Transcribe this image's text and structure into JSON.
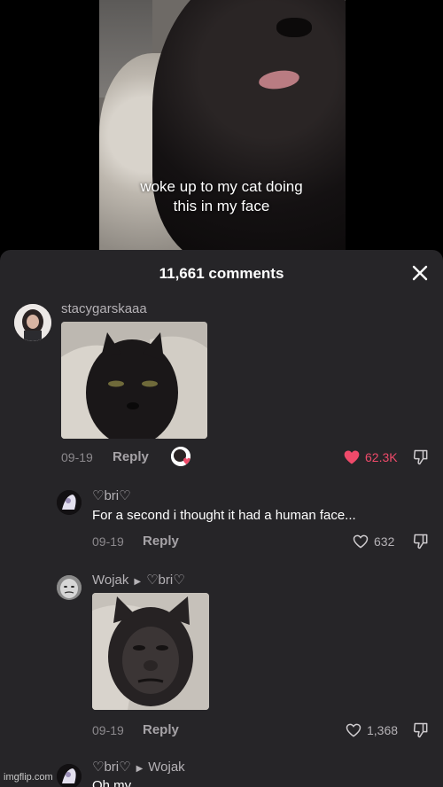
{
  "video": {
    "caption_line1": "woke up to my cat doing",
    "caption_line2": "this in my face"
  },
  "comments_sheet": {
    "title": "11,661 comments",
    "close_icon": "close-icon"
  },
  "comments": [
    {
      "username": "stacygarskaaa",
      "date": "09-19",
      "reply_label": "Reply",
      "likes": "62.3K",
      "liked": true,
      "has_image": true
    },
    {
      "username": "♡bri♡",
      "text": "For a second i thought it had a human face...",
      "date": "09-19",
      "reply_label": "Reply",
      "likes": "632"
    },
    {
      "username": "Wojak",
      "reply_to": "♡bri♡",
      "date": "09-19",
      "reply_label": "Reply",
      "likes": "1,368",
      "has_image": true
    },
    {
      "username": "♡bri♡",
      "reply_to": "Wojak",
      "text": "Oh my"
    }
  ],
  "colors": {
    "sheet_bg": "#262528",
    "liked_heart": "#ef4a6a",
    "muted_text": "#b5b2b6"
  },
  "watermark": "imgflip.com"
}
